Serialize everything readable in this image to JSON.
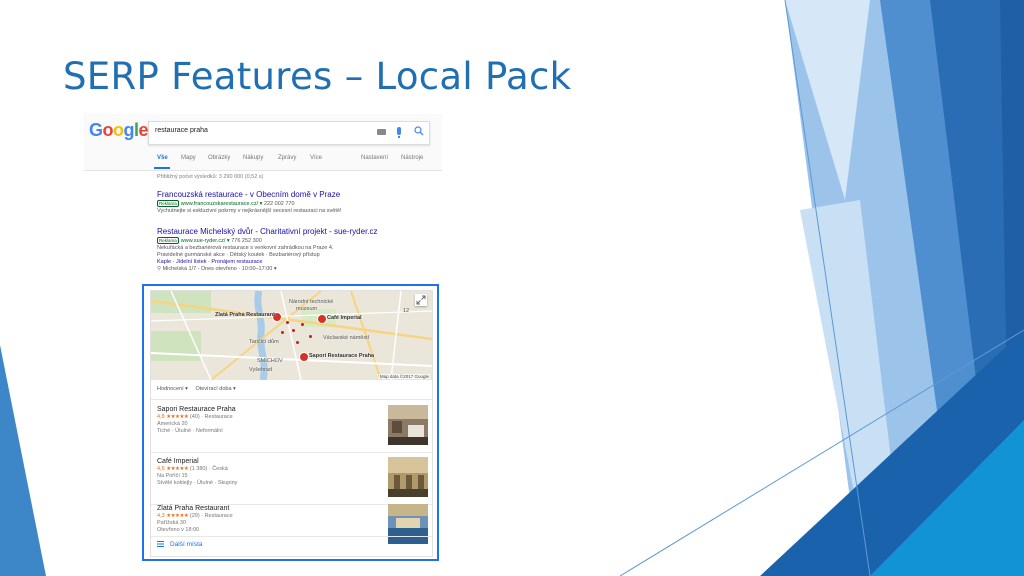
{
  "slide": {
    "title": "SERP Features – Local Pack"
  },
  "search": {
    "logo": "Google",
    "query": "restaurace praha",
    "tabs": [
      "Vše",
      "Mapy",
      "Obrázky",
      "Nákupy",
      "Zprávy",
      "Více",
      "Nastavení",
      "Nástroje"
    ],
    "result_count": "Přibližný počet výsledků: 3 290 000 (0,52 s)"
  },
  "ads": [
    {
      "title": "Francouzská restaurace - v Obecním domě v Praze",
      "badge": "Reklama",
      "url": "www.francouzskarestaurace.cz/",
      "phone": "222 002 770",
      "desc": [
        "Vychutnejte si exkluzivní pokrmy v nejkrásnější secesní restauraci na světě!"
      ]
    },
    {
      "title": "Restaurace Michelský dvůr - Charitativní projekt - sue-ryder.cz",
      "badge": "Reklama",
      "url": "www.sue-ryder.cz/",
      "phone": "776 252 300",
      "desc": [
        "Nekuřácká a bezbariérová restaurace s venkovní zahrádkou na Praze 4.",
        "Pravidelné gurmánské akce · Dětský koutek · Bezbariérový přístup"
      ],
      "links": "Kaple · Jídelní lístek · Pronájem restaurace",
      "location": "Michelská 1/7 - Dnes otevřeno · 10:00–17:00 ▾"
    }
  ],
  "map": {
    "labels": {
      "zlata": "Zlatá Praha Restaurant",
      "cafe": "Café Imperial",
      "narodni": "Národní technické",
      "muzeum": "muzeum",
      "vaclavske": "Václavské náměstí",
      "tancici": "Tančící dům",
      "sapori": "Sapori Restaurace Praha",
      "smichov": "SMÍCHOV",
      "vysehrad": "Vyšehrad",
      "num": "12"
    },
    "credit": "Map data ©2017 Google"
  },
  "filters": [
    "Hodnocení ▾",
    "Otevírací doba ▾"
  ],
  "places": [
    {
      "name": "Sapori Restaurace Praha",
      "score": "4,8",
      "stars": "★★★★★",
      "reviews": "(40) · Restaurace",
      "address": "Americká 20",
      "tags": "Tiché · Útulné · Neformální"
    },
    {
      "name": "Café Imperial",
      "score": "4,6",
      "stars": "★★★★★",
      "reviews": "(1 380) · Česká",
      "address": "Na Poříčí 15",
      "tags": "Stvělé koktejly · Útulné · Skupiny"
    },
    {
      "name": "Zlatá Praha Restaurant",
      "score": "4,3",
      "stars": "★★★★★",
      "reviews": "(29) · Restaurace",
      "address": "Pařížská 30",
      "tags": "Otevřeno v 18:00"
    }
  ],
  "more_link": "Další místa",
  "colors": {
    "title": "#1f6fb2",
    "highlight": "#1e73e8",
    "link": "#1a0dab",
    "url": "#006621",
    "star": "#e7711b"
  },
  "icons": [
    "keyboard-icon",
    "mic-icon",
    "search-icon",
    "expand-icon",
    "map-pin-icon",
    "list-icon"
  ]
}
